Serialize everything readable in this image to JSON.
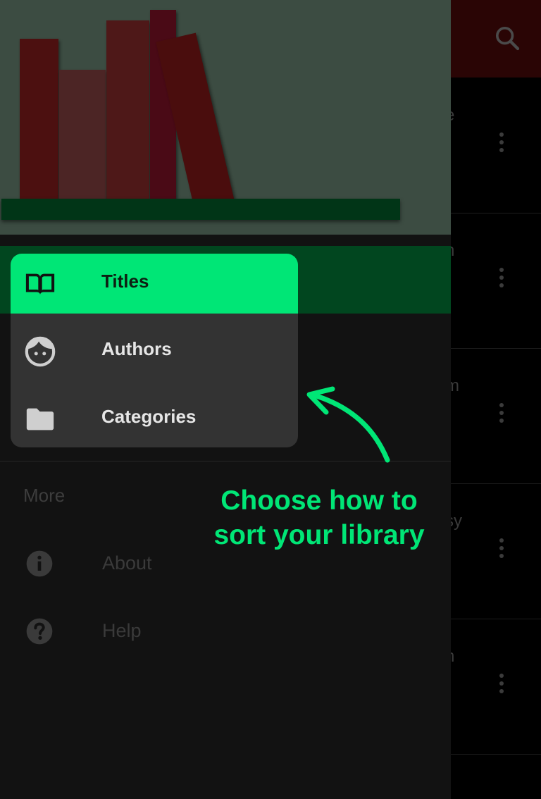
{
  "app": {
    "search_icon": "search-icon",
    "row_peek_texts": [
      "e",
      "n",
      "m",
      "sy",
      "n"
    ],
    "row_menu_icon": "more-vert-icon"
  },
  "drawer": {
    "header_illustration": "bookshelf-illustration",
    "nav_items": [
      {
        "label": "Titles",
        "icon": "book-open-icon",
        "selected": true
      },
      {
        "label": "Authors",
        "icon": "face-icon",
        "selected": false
      },
      {
        "label": "Categories",
        "icon": "folder-icon",
        "selected": false
      }
    ],
    "more_section": {
      "label": "More",
      "items": [
        {
          "label": "About",
          "icon": "info-icon"
        },
        {
          "label": "Help",
          "icon": "help-icon"
        }
      ]
    }
  },
  "callout": {
    "line1": "Choose how to",
    "line2": "sort your library",
    "color": "#00e676"
  },
  "colors": {
    "accent": "#00e676",
    "drawer_bg": "#121212",
    "header_bg": "#3c4c42",
    "card_bg": "#333333"
  }
}
